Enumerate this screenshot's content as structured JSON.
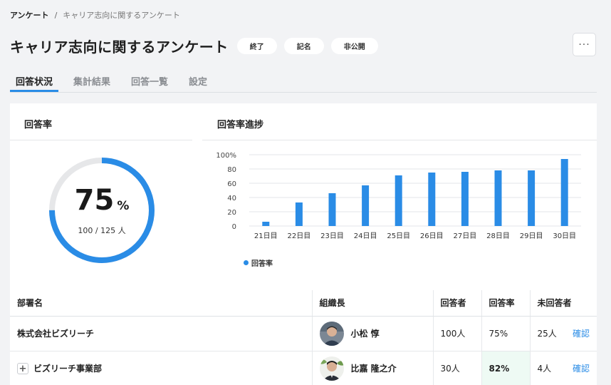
{
  "breadcrumb": {
    "home": "アンケート",
    "separator": "/",
    "current": "キャリア志向に関するアンケート"
  },
  "page": {
    "title": "キャリア志向に関するアンケート",
    "badges": [
      "終了",
      "記名",
      "非公開"
    ],
    "more_label": "···"
  },
  "tabs": [
    {
      "label": "回答状況",
      "active": true
    },
    {
      "label": "集計結果",
      "active": false
    },
    {
      "label": "回答一覧",
      "active": false
    },
    {
      "label": "設定",
      "active": false
    }
  ],
  "rate_panel": {
    "title": "回答率",
    "percent": "75",
    "percent_unit": "%",
    "detail": "100 / 125 人",
    "fraction": 0.75
  },
  "progress_panel": {
    "title": "回答率進捗"
  },
  "chart_data": {
    "type": "bar",
    "categories": [
      "21日目",
      "22日目",
      "23日目",
      "24日目",
      "25日目",
      "26日目",
      "27日目",
      "28日目",
      "29日目",
      "30日目"
    ],
    "series": [
      {
        "name": "回答率",
        "values": [
          6,
          33,
          46,
          57,
          71,
          75,
          76,
          78,
          78,
          94
        ]
      }
    ],
    "y_ticks": [
      "0",
      "20",
      "40",
      "60",
      "80",
      "100%"
    ],
    "ylim": [
      0,
      100
    ],
    "grid": true,
    "legend_position": "bottom-left",
    "color": "#2a8ce6"
  },
  "table": {
    "headers": [
      "部署名",
      "組織長",
      "回答者",
      "回答率",
      "未回答者"
    ],
    "rows": [
      {
        "dept": "株式会社ビズリーチ",
        "expandable": false,
        "leader": "小松 惇",
        "respondents": "100人",
        "rate": "75%",
        "highlight": false,
        "unanswered": "25人",
        "action": "確認"
      },
      {
        "dept": "ビズリーチ事業部",
        "expandable": true,
        "leader": "比嘉 隆之介",
        "respondents": "30人",
        "rate": "82%",
        "highlight": true,
        "unanswered": "4人",
        "action": "確認"
      }
    ]
  },
  "colors": {
    "accent": "#2a8ce6",
    "highlight_text": "#1a9b5a",
    "highlight_bg": "#eefaf4",
    "gauge_track": "#e6e7e9"
  }
}
